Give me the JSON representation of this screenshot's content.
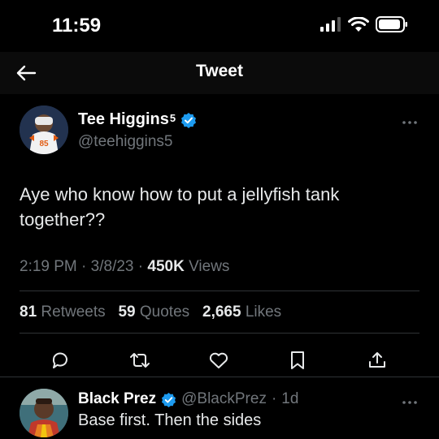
{
  "status_bar": {
    "time": "11:59"
  },
  "nav": {
    "title": "Tweet"
  },
  "tweet": {
    "author_name": "Tee Higgins",
    "author_superscript": "5",
    "handle": "@teehiggins5",
    "text": "Aye who know how to put a jellyfish tank together??",
    "time": "2:19 PM",
    "date": "3/8/23",
    "views_count": "450K",
    "views_label": "Views",
    "retweets_count": "81",
    "retweets_label": "Retweets",
    "quotes_count": "59",
    "quotes_label": "Quotes",
    "likes_count": "2,665",
    "likes_label": "Likes"
  },
  "reply": {
    "name": "Black Prez",
    "handle": "@BlackPrez",
    "age": "1d",
    "text": "Base first. Then the sides"
  },
  "icons": {
    "back": "arrow-left-icon",
    "verified": "verified-badge-icon",
    "more": "more-dots-icon",
    "reply": "reply-icon",
    "retweet": "retweet-icon",
    "like": "heart-icon",
    "bookmark": "bookmark-icon",
    "share": "share-icon"
  },
  "colors": {
    "background": "#000000",
    "text_primary": "#e7e9ea",
    "text_secondary": "#71767b",
    "verified": "#1d9bf0",
    "divider": "#2f3336"
  }
}
